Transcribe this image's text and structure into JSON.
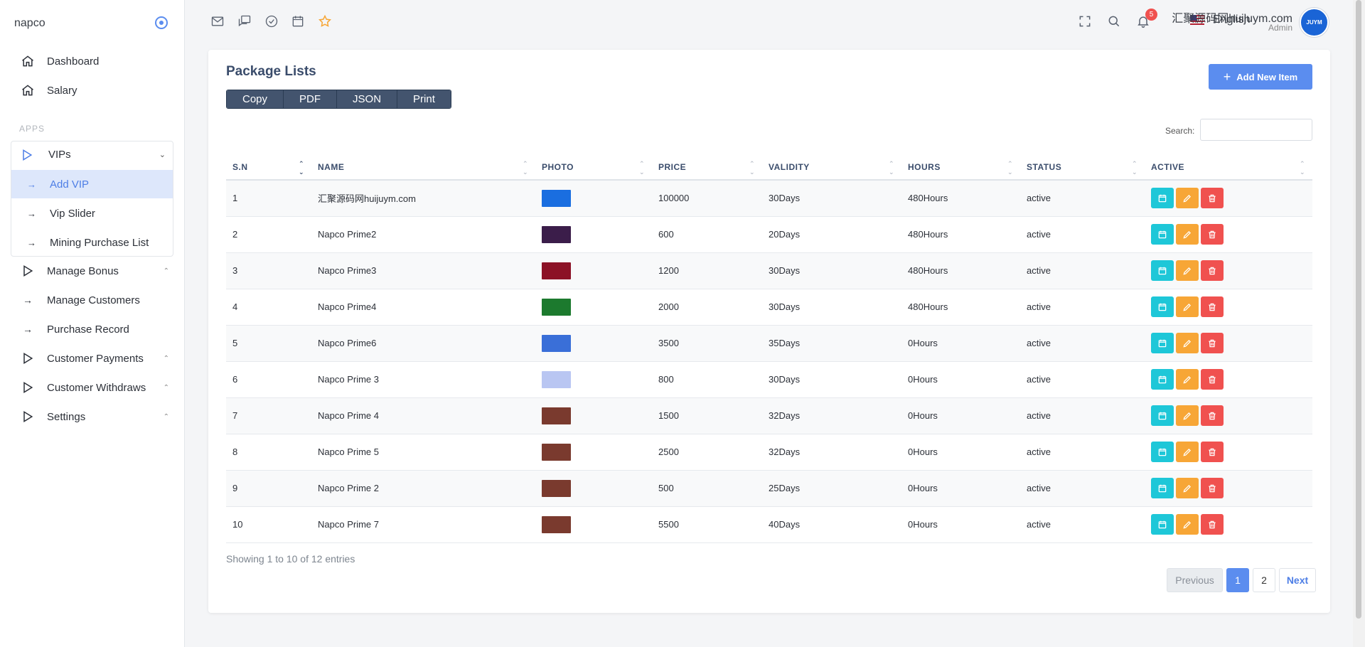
{
  "brand": "napco",
  "sidebar": {
    "top_items": [
      {
        "label": "Dashboard",
        "icon": "home-icon"
      },
      {
        "label": "Salary",
        "icon": "home-icon"
      }
    ],
    "section_label": "APPS",
    "vips": {
      "label": "VIPs",
      "children": [
        "Add VIP",
        "Vip Slider",
        "Mining Purchase List"
      ]
    },
    "items": [
      {
        "label": "Manage Bonus",
        "icon": "play-icon",
        "caret": true
      },
      {
        "label": "Manage Customers",
        "icon": "arrow-right-icon",
        "caret": false
      },
      {
        "label": "Purchase Record",
        "icon": "arrow-right-icon",
        "caret": false
      },
      {
        "label": "Customer Payments",
        "icon": "play-icon",
        "caret": true
      },
      {
        "label": "Customer Withdraws",
        "icon": "play-icon",
        "caret": true
      },
      {
        "label": "Settings",
        "icon": "play-icon",
        "caret": true
      }
    ]
  },
  "header": {
    "language": "English",
    "notification_count": "5",
    "user_name": "汇聚源码网huijuym.com",
    "user_role": "Admin"
  },
  "card": {
    "title": "Package Lists",
    "export_buttons": [
      "Copy",
      "PDF",
      "JSON",
      "Print"
    ],
    "add_button": "Add New Item",
    "search_label": "Search:",
    "columns": [
      "S.N",
      "NAME",
      "PHOTO",
      "PRICE",
      "VALIDITY",
      "HOURS",
      "STATUS",
      "ACTIVE"
    ],
    "rows": [
      {
        "sn": "1",
        "name": "汇聚源码网huijuym.com",
        "photo": "#1a6ee0",
        "price": "100000",
        "validity": "30Days",
        "hours": "480Hours",
        "status": "active"
      },
      {
        "sn": "2",
        "name": "Napco Prime2",
        "photo": "#3b1d4a",
        "price": "600",
        "validity": "20Days",
        "hours": "480Hours",
        "status": "active"
      },
      {
        "sn": "3",
        "name": "Napco Prime3",
        "photo": "#8c1226",
        "price": "1200",
        "validity": "30Days",
        "hours": "480Hours",
        "status": "active"
      },
      {
        "sn": "4",
        "name": "Napco Prime4",
        "photo": "#1c7a2e",
        "price": "2000",
        "validity": "30Days",
        "hours": "480Hours",
        "status": "active"
      },
      {
        "sn": "5",
        "name": "Napco Prime6",
        "photo": "#3a6fd8",
        "price": "3500",
        "validity": "35Days",
        "hours": "0Hours",
        "status": "active"
      },
      {
        "sn": "6",
        "name": "Napco Prime 3",
        "photo": "#b9c6f2",
        "price": "800",
        "validity": "30Days",
        "hours": "0Hours",
        "status": "active"
      },
      {
        "sn": "7",
        "name": "Napco Prime 4",
        "photo": "#7a3a2e",
        "price": "1500",
        "validity": "32Days",
        "hours": "0Hours",
        "status": "active"
      },
      {
        "sn": "8",
        "name": "Napco Prime 5",
        "photo": "#7a3a2e",
        "price": "2500",
        "validity": "32Days",
        "hours": "0Hours",
        "status": "active"
      },
      {
        "sn": "9",
        "name": "Napco Prime 2",
        "photo": "#7a3a2e",
        "price": "500",
        "validity": "25Days",
        "hours": "0Hours",
        "status": "active"
      },
      {
        "sn": "10",
        "name": "Napco Prime 7",
        "photo": "#7a3a2e",
        "price": "5500",
        "validity": "40Days",
        "hours": "0Hours",
        "status": "active"
      }
    ],
    "showing": "Showing 1 to 10 of 12 entries",
    "pagination": {
      "prev": "Previous",
      "pages": [
        "1",
        "2"
      ],
      "next": "Next",
      "active": "1"
    }
  },
  "colors": {
    "accent": "#5b8def",
    "export_dark": "#43546e",
    "view": "#1ec7d8",
    "edit": "#f7a636",
    "delete": "#f0514f"
  }
}
